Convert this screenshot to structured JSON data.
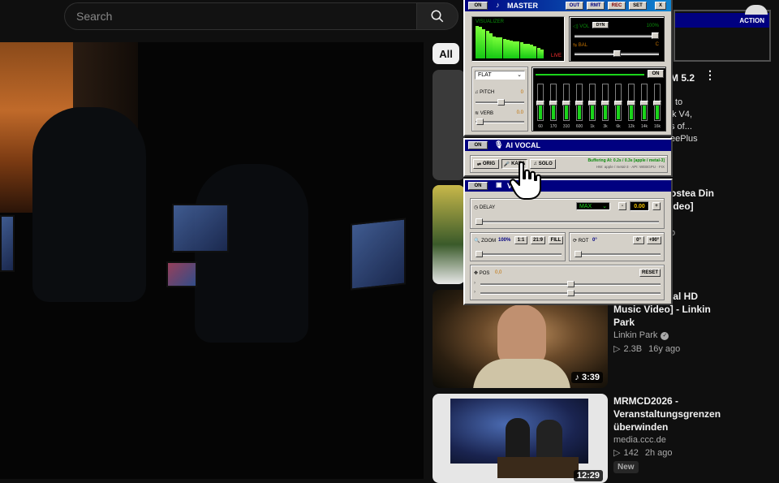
{
  "search": {
    "placeholder": "Search"
  },
  "chips": {
    "all": "All"
  },
  "sidebar": {
    "partial_1": {
      "title_line": "M 5.2",
      "lines": [
        "to",
        "k V4,",
        "s of...",
        "eePlus"
      ]
    },
    "partial_2": {
      "title_line": "ostea Din",
      "line2": "ideo]",
      "line3": "o"
    },
    "video_1": {
      "title_line1": "ficial HD",
      "title_line2": "Music Video] - Linkin",
      "title_line3": "Park",
      "channel": "Linkin Park",
      "views": "2.3B",
      "age": "16y ago",
      "duration": "3:39"
    },
    "video_2": {
      "title_line1": "MRMCD2026 -",
      "title_line2": "Veranstaltungsgrenzen",
      "title_line3": "überwinden",
      "channel": "media.ccc.de",
      "views": "142",
      "age": "2h ago",
      "badge": "New",
      "duration": "12:29"
    }
  },
  "mixer": {
    "master": {
      "on": "ON",
      "title": "MASTER",
      "buttons": [
        "OUT",
        "RMT",
        "REC",
        "SET",
        "X"
      ],
      "visualizer_label": "VISUALIZER",
      "live_label": "LIVE",
      "viz_levels": [
        0.92,
        0.88,
        0.82,
        0.78,
        0.7,
        0.62,
        0.6,
        0.58,
        0.55,
        0.52,
        0.5,
        0.48,
        0.47,
        0.45,
        0.42,
        0.4,
        0.38,
        0.34,
        0.3,
        0.26
      ],
      "vol_label": "VOL",
      "dyn_label": "DYN",
      "vol_value": "100%",
      "bal_label": "BAL",
      "bal_value": "C",
      "preset": "FLAT",
      "eq_on": "ON",
      "pitch_label": "PITCH",
      "pitch_value": "0",
      "verb_label": "VERB",
      "verb_value": "0.0",
      "eq_bands": [
        "60",
        "170",
        "310",
        "600",
        "1k",
        "3k",
        "6k",
        "12k",
        "14k",
        "16k"
      ]
    },
    "ai_vocal": {
      "on": "ON",
      "title": "AI VOCAL",
      "buttons": [
        "ORIG",
        "KARA",
        "SOLO"
      ],
      "status_line1": "Buffering AI: 0.2s / 0.3s [apple / metal-3]",
      "status_line2": "HW: apple / metal-3 · API: WEBGPU · FIX"
    },
    "video": {
      "on": "ON",
      "title": "V",
      "delay_label": "DELAY",
      "delay_mode": "MAX",
      "delay_minus": "-",
      "delay_value": "0.00",
      "delay_plus": "+",
      "zoom_label": "ZOOM",
      "zoom_value": "100%",
      "zoom_buttons": [
        "1:1",
        "21:9",
        "FILL"
      ],
      "rot_label": "ROT",
      "rot_value": "0°",
      "rot_buttons": [
        "0°",
        "+90°"
      ],
      "pos_label": "POS",
      "pos_value": "0,0",
      "reset": "RESET"
    },
    "action": {
      "title": "ACTION"
    }
  },
  "colors": {
    "bg": "#0f0f0f",
    "accent_blue": "#000080",
    "eq_green": "#1bd41b"
  }
}
